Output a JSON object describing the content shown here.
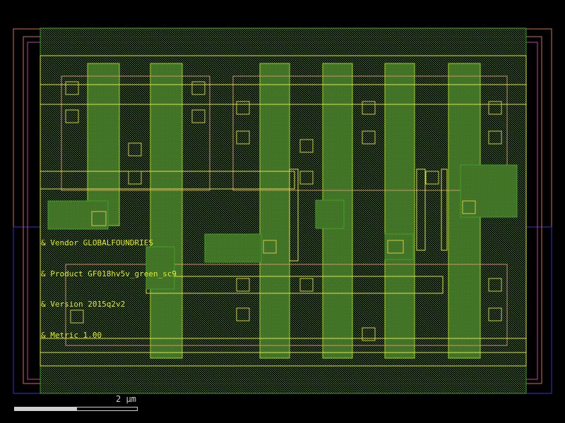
{
  "canvas": {
    "background": "#000000"
  },
  "layers": {
    "nwell": "#d07050",
    "pwell": "#4030c0",
    "diff": "#40a030",
    "poly": "#a8d020",
    "metal": "#e8e040",
    "contact": "#d0c040",
    "boundary": "#d04090"
  },
  "labels": [
    "& Vendor GLOBALFOUNDRIES",
    "& Product GF018hv5v_green_sc9",
    "& Version 2015q2v2",
    "& Metric 1.00"
  ],
  "scale": {
    "text": "2  µm"
  }
}
